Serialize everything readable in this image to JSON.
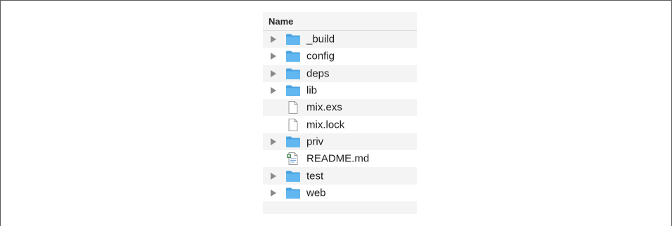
{
  "header": {
    "name_label": "Name"
  },
  "items": [
    {
      "name": "_build",
      "kind": "folder",
      "icon": "folder-icon",
      "expandable": true
    },
    {
      "name": "config",
      "kind": "folder",
      "icon": "folder-icon",
      "expandable": true
    },
    {
      "name": "deps",
      "kind": "folder",
      "icon": "folder-icon",
      "expandable": true
    },
    {
      "name": "lib",
      "kind": "folder",
      "icon": "folder-icon",
      "expandable": true
    },
    {
      "name": "mix.exs",
      "kind": "file",
      "icon": "document-icon",
      "expandable": false
    },
    {
      "name": "mix.lock",
      "kind": "file",
      "icon": "document-icon",
      "expandable": false
    },
    {
      "name": "priv",
      "kind": "folder",
      "icon": "folder-icon",
      "expandable": true
    },
    {
      "name": "README.md",
      "kind": "markdown",
      "icon": "markdown-document-icon",
      "expandable": false
    },
    {
      "name": "test",
      "kind": "folder",
      "icon": "folder-icon",
      "expandable": true
    },
    {
      "name": "web",
      "kind": "folder",
      "icon": "folder-icon",
      "expandable": true
    }
  ],
  "colors": {
    "folder_body": "#62b7f0",
    "folder_tab": "#4aa3e0",
    "stripe": "#f4f4f4",
    "header_bg": "#f5f5f5"
  }
}
